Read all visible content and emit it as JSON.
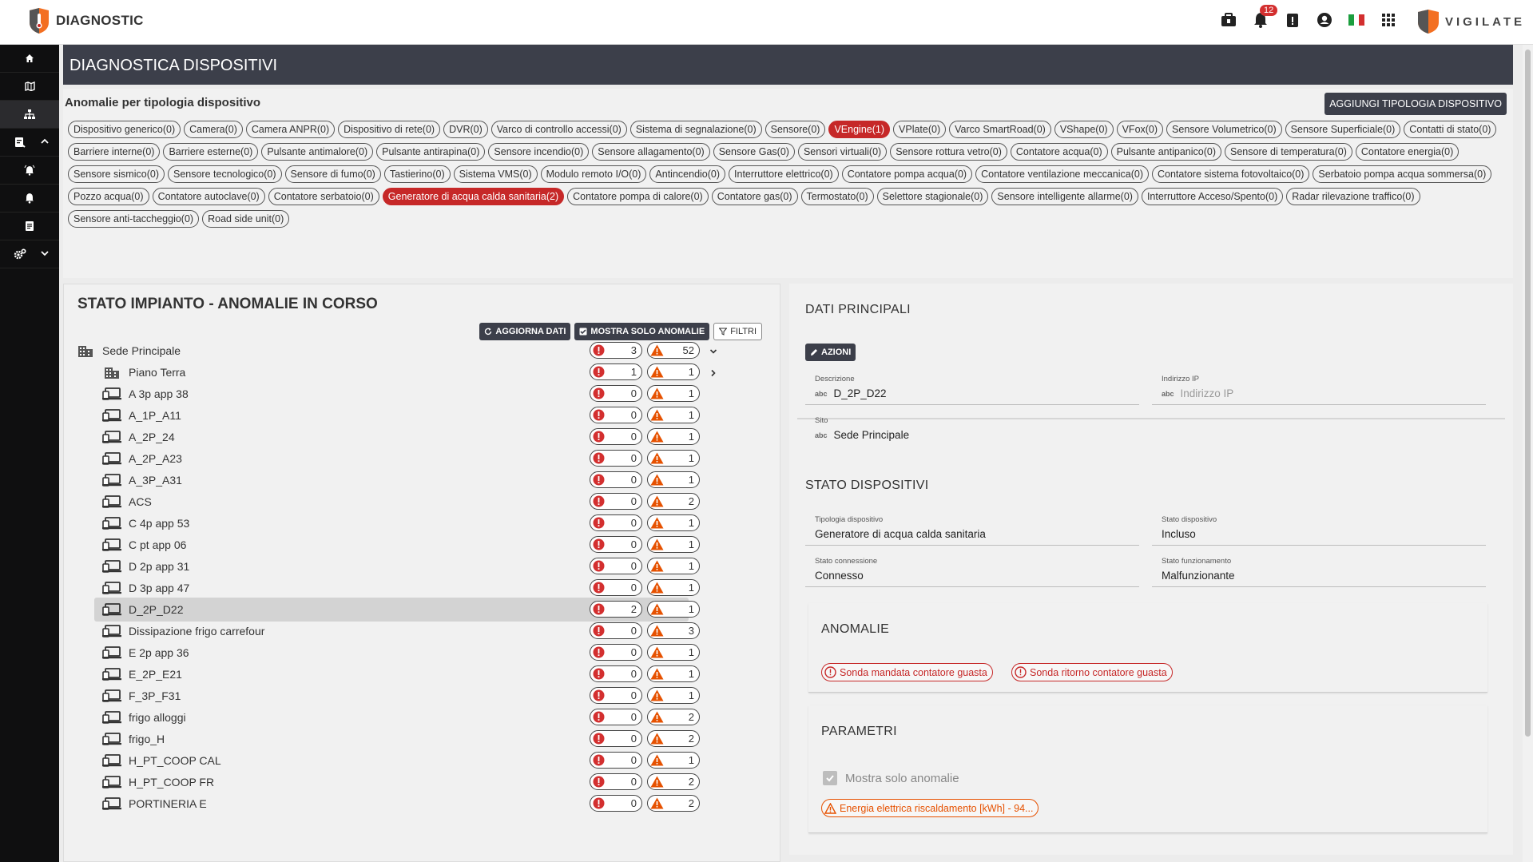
{
  "app": {
    "title": "DIAGNOSTIC",
    "brand_right": "VIGILATE",
    "notification_count": "12"
  },
  "top_icons": [
    "briefcase-icon",
    "bell-icon",
    "clipboard-alert-icon",
    "account-icon",
    "italy-flag-icon",
    "apps-grid-icon"
  ],
  "sidebar": {
    "items": [
      {
        "icon": "home-icon"
      },
      {
        "icon": "map-icon"
      },
      {
        "icon": "sitemap-icon"
      },
      {
        "icon": "report-icon"
      },
      {
        "icon": "alarm-icon"
      },
      {
        "icon": "bell-icon"
      },
      {
        "icon": "document-icon"
      },
      {
        "icon": "settings-icon"
      }
    ]
  },
  "page": {
    "title": "DIAGNOSTICA DISPOSITIVI"
  },
  "types": {
    "title": "Anomalie per tipologia dispositivo",
    "add_button": "AGGIUNGI TIPOLOGIA DISPOSITIVO",
    "chips": [
      {
        "label": "Dispositivo generico(0)",
        "alert": false
      },
      {
        "label": "Camera(0)",
        "alert": false
      },
      {
        "label": "Camera ANPR(0)",
        "alert": false
      },
      {
        "label": "Dispositivo di rete(0)",
        "alert": false
      },
      {
        "label": "DVR(0)",
        "alert": false
      },
      {
        "label": "Varco di controllo accessi(0)",
        "alert": false
      },
      {
        "label": "Sistema di segnalazione(0)",
        "alert": false
      },
      {
        "label": "Sensore(0)",
        "alert": false
      },
      {
        "label": "VEngine(1)",
        "alert": true
      },
      {
        "label": "VPlate(0)",
        "alert": false
      },
      {
        "label": "Varco SmartRoad(0)",
        "alert": false
      },
      {
        "label": "VShape(0)",
        "alert": false
      },
      {
        "label": "VFox(0)",
        "alert": false
      },
      {
        "label": "Sensore Volumetrico(0)",
        "alert": false
      },
      {
        "label": "Sensore Superficiale(0)",
        "alert": false
      },
      {
        "label": "Contatti di stato(0)",
        "alert": false
      },
      {
        "label": "Barriere interne(0)",
        "alert": false
      },
      {
        "label": "Barriere esterne(0)",
        "alert": false
      },
      {
        "label": "Pulsante antimalore(0)",
        "alert": false
      },
      {
        "label": "Pulsante antirapina(0)",
        "alert": false
      },
      {
        "label": "Sensore incendio(0)",
        "alert": false
      },
      {
        "label": "Sensore allagamento(0)",
        "alert": false
      },
      {
        "label": "Sensore Gas(0)",
        "alert": false
      },
      {
        "label": "Sensori virtuali(0)",
        "alert": false
      },
      {
        "label": "Sensore rottura vetro(0)",
        "alert": false
      },
      {
        "label": "Contatore acqua(0)",
        "alert": false
      },
      {
        "label": "Pulsante antipanico(0)",
        "alert": false
      },
      {
        "label": "Sensore di temperatura(0)",
        "alert": false
      },
      {
        "label": "Contatore energia(0)",
        "alert": false
      },
      {
        "label": "Sensore sismico(0)",
        "alert": false
      },
      {
        "label": "Sensore tecnologico(0)",
        "alert": false
      },
      {
        "label": "Sensore di fumo(0)",
        "alert": false
      },
      {
        "label": "Tastierino(0)",
        "alert": false
      },
      {
        "label": "Sistema VMS(0)",
        "alert": false
      },
      {
        "label": "Modulo remoto I/O(0)",
        "alert": false
      },
      {
        "label": "Antincendio(0)",
        "alert": false
      },
      {
        "label": "Interruttore elettrico(0)",
        "alert": false
      },
      {
        "label": "Contatore pompa acqua(0)",
        "alert": false
      },
      {
        "label": "Contatore ventilazione meccanica(0)",
        "alert": false
      },
      {
        "label": "Contatore sistema fotovoltaico(0)",
        "alert": false
      },
      {
        "label": "Serbatoio pompa acqua sommersa(0)",
        "alert": false
      },
      {
        "label": "Pozzo acqua(0)",
        "alert": false
      },
      {
        "label": "Contatore autoclave(0)",
        "alert": false
      },
      {
        "label": "Contatore serbatoio(0)",
        "alert": false
      },
      {
        "label": "Generatore di acqua calda sanitaria(2)",
        "alert": true
      },
      {
        "label": "Contatore pompa di calore(0)",
        "alert": false
      },
      {
        "label": "Contatore gas(0)",
        "alert": false
      },
      {
        "label": "Termostato(0)",
        "alert": false
      },
      {
        "label": "Selettore stagionale(0)",
        "alert": false
      },
      {
        "label": "Sensore intelligente allarme(0)",
        "alert": false
      },
      {
        "label": "Interruttore Acceso/Spento(0)",
        "alert": false
      },
      {
        "label": "Radar rilevazione traffico(0)",
        "alert": false
      },
      {
        "label": "Sensore anti-taccheggio(0)",
        "alert": false
      },
      {
        "label": "Road side unit(0)",
        "alert": false
      }
    ]
  },
  "plant": {
    "title": "STATO IMPIANTO - ANOMALIE IN CORSO",
    "buttons": {
      "refresh": "AGGIORNA DATI",
      "only_anomalies": "MOSTRA SOLO ANOMALIE",
      "filters": "FILTRI"
    },
    "rows": [
      {
        "label": "Sede Principale",
        "level": 0,
        "kind": "building",
        "errors": "3",
        "warnings": "52",
        "chevron": "down",
        "selected": false
      },
      {
        "label": "Piano Terra",
        "level": 1,
        "kind": "building",
        "errors": "1",
        "warnings": "1",
        "chevron": "right",
        "selected": false
      },
      {
        "label": "A 3p app 38",
        "level": 1,
        "kind": "device",
        "errors": "0",
        "warnings": "1",
        "chevron": "",
        "selected": false
      },
      {
        "label": "A_1P_A11",
        "level": 1,
        "kind": "device",
        "errors": "0",
        "warnings": "1",
        "chevron": "",
        "selected": false
      },
      {
        "label": "A_2P_24",
        "level": 1,
        "kind": "device",
        "errors": "0",
        "warnings": "1",
        "chevron": "",
        "selected": false
      },
      {
        "label": "A_2P_A23",
        "level": 1,
        "kind": "device",
        "errors": "0",
        "warnings": "1",
        "chevron": "",
        "selected": false
      },
      {
        "label": "A_3P_A31",
        "level": 1,
        "kind": "device",
        "errors": "0",
        "warnings": "1",
        "chevron": "",
        "selected": false
      },
      {
        "label": "ACS",
        "level": 1,
        "kind": "device",
        "errors": "0",
        "warnings": "2",
        "chevron": "",
        "selected": false
      },
      {
        "label": "C 4p app 53",
        "level": 1,
        "kind": "device",
        "errors": "0",
        "warnings": "1",
        "chevron": "",
        "selected": false
      },
      {
        "label": "C pt app 06",
        "level": 1,
        "kind": "device",
        "errors": "0",
        "warnings": "1",
        "chevron": "",
        "selected": false
      },
      {
        "label": "D 2p app 31",
        "level": 1,
        "kind": "device",
        "errors": "0",
        "warnings": "1",
        "chevron": "",
        "selected": false
      },
      {
        "label": "D 3p app 47",
        "level": 1,
        "kind": "device",
        "errors": "0",
        "warnings": "1",
        "chevron": "",
        "selected": false
      },
      {
        "label": "D_2P_D22",
        "level": 1,
        "kind": "device",
        "errors": "2",
        "warnings": "1",
        "chevron": "",
        "selected": true
      },
      {
        "label": "Dissipazione frigo carrefour",
        "level": 1,
        "kind": "device",
        "errors": "0",
        "warnings": "3",
        "chevron": "",
        "selected": false
      },
      {
        "label": "E 2p app 36",
        "level": 1,
        "kind": "device",
        "errors": "0",
        "warnings": "1",
        "chevron": "",
        "selected": false
      },
      {
        "label": "E_2P_E21",
        "level": 1,
        "kind": "device",
        "errors": "0",
        "warnings": "1",
        "chevron": "",
        "selected": false
      },
      {
        "label": "F_3P_F31",
        "level": 1,
        "kind": "device",
        "errors": "0",
        "warnings": "1",
        "chevron": "",
        "selected": false
      },
      {
        "label": "frigo alloggi",
        "level": 1,
        "kind": "device",
        "errors": "0",
        "warnings": "2",
        "chevron": "",
        "selected": false
      },
      {
        "label": "frigo_H",
        "level": 1,
        "kind": "device",
        "errors": "0",
        "warnings": "2",
        "chevron": "",
        "selected": false
      },
      {
        "label": "H_PT_COOP CAL",
        "level": 1,
        "kind": "device",
        "errors": "0",
        "warnings": "1",
        "chevron": "",
        "selected": false
      },
      {
        "label": "H_PT_COOP FR",
        "level": 1,
        "kind": "device",
        "errors": "0",
        "warnings": "2",
        "chevron": "",
        "selected": false
      },
      {
        "label": "PORTINERIA E",
        "level": 1,
        "kind": "device",
        "errors": "0",
        "warnings": "2",
        "chevron": "",
        "selected": false
      }
    ]
  },
  "details": {
    "main_title": "DATI PRINCIPALI",
    "actions_button": "AZIONI",
    "descrizione_label": "Descrizione",
    "descrizione_value": "D_2P_D22",
    "ip_label": "Indirizzo IP",
    "ip_placeholder": "Indirizzo IP",
    "sito_label": "Sito",
    "sito_value": "Sede Principale",
    "status_title": "STATO DISPOSITIVI",
    "tipologia_label": "Tipologia dispositivo",
    "tipologia_value": "Generatore di acqua calda sanitaria",
    "stato_label": "Stato dispositivo",
    "stato_value": "Incluso",
    "connessione_label": "Stato connessione",
    "connessione_value": "Connesso",
    "funzionamento_label": "Stato funzionamento",
    "funzionamento_value": "Malfunzionante",
    "anomalies_title": "ANOMALIE",
    "anomalies": [
      "Sonda mandata contatore guasta",
      "Sonda ritorno contatore guasta"
    ],
    "params_title": "PARAMETRI",
    "only_anomalies_label": "Mostra solo anomalie",
    "param_chip": "Energia elettrica riscaldamento [kWh] - 94..."
  },
  "colors": {
    "accent_dark": "#3c3f4a",
    "alert_red": "#c62828",
    "warning_orange": "#e65100",
    "sidebar_bg": "#0f0f10"
  }
}
